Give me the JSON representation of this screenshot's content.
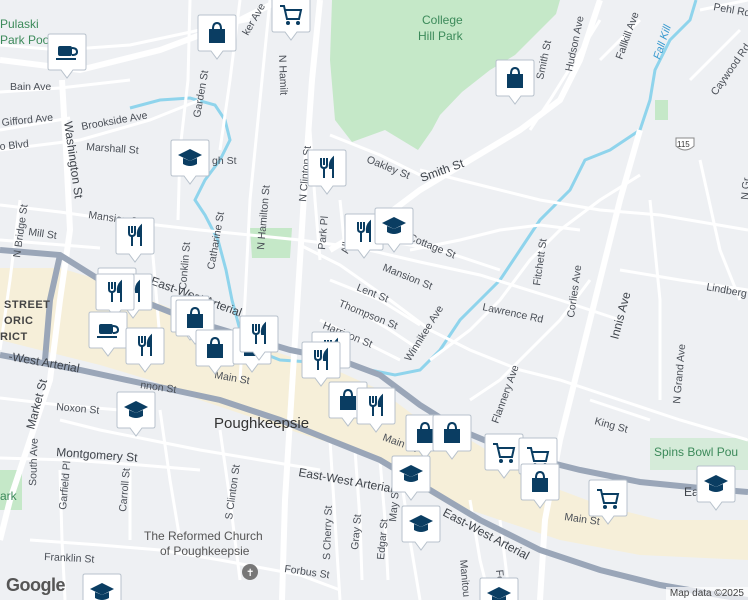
{
  "attribution": {
    "logo": "Google",
    "map_data": "Map data ©2025"
  },
  "places": {
    "city": "Poughkeepsie",
    "park": [
      "College",
      "Hill Park"
    ],
    "park_left": [
      "Pulaski",
      "Park Pool"
    ],
    "district": [
      "STREET",
      "ORIC",
      "RICT"
    ],
    "church": [
      "The Reformed Church",
      "of Poughkeepsie"
    ],
    "spins": "Spins Bowl Pou",
    "park_small": "ark",
    "fall_kill": "Fall Kill"
  },
  "roads": {
    "smith_st": "Smith St",
    "smith_st2": "Smith St",
    "washington_st": "Washington St",
    "market_st": "Market St",
    "east_west_arterial": "East-West Arterial",
    "east_west_arterial_w": "-West Arterial",
    "east_west_arterial_e": "East-West Arterial",
    "east_west_arterial_se": "East-West Arterial",
    "east_west_arterial_far": "East",
    "main_st": "Main St",
    "main_st_e": "Main St",
    "main_st_w": "Main St",
    "innis_ave": "Innis Ave",
    "mansion_st_w": "Mansion St",
    "mansion_st": "Mansion St",
    "lent_st": "Lent St",
    "thompson_st": "Thompson St",
    "harrison_st": "Harrison St",
    "winnikee_ave": "Winnikee Ave",
    "lawrence_rd": "Lawrence Rd",
    "fitchett_st": "Fitchett St",
    "corlies_ave": "Corlies Ave",
    "flannery_ave": "Flannery Ave",
    "king_st": "King St",
    "n_grand_ave": "N Grand Ave",
    "lindberg": "Lindberg",
    "hudson_ave": "Hudson Ave",
    "fallkill_ave": "Fallkill Ave",
    "caywood_rd": "Caywood Rd",
    "pehl_rd": "Pehl Rd",
    "oakley_st": "Oakley St",
    "cottage_st": "Cottage St",
    "allen_pl": "Allen Pl",
    "park_pl": "Park Pl",
    "n_clinton_st": "N Clinton St",
    "n_hamilton_st": "N Hamilton St",
    "n_hamilton_top": "N Hamilt",
    "catharine_st": "Catharine St",
    "conklin_st": "Conklin St",
    "garden_st": "Garden St",
    "mill_st": "Mill St",
    "n_bridge_st": "N Bridge St",
    "marshall_st": "Marshall St",
    "brookside_ave": "Brookside Ave",
    "gifford_ave": "Gifford Ave",
    "bain_ave": "Bain Ave",
    "blvd": "o Blvd",
    "noxon_st": "Noxon St",
    "montgomery_st": "Montgomery St",
    "garfield_pl": "Garfield Pl",
    "carroll_st": "Carroll St",
    "south_ave": "South Ave",
    "franklin_st": "Franklin St",
    "s_clinton_st": "S Clinton St",
    "s_cherry_st": "S Cherry St",
    "gray_st": "Gray St",
    "edgar_st": "Edgar St",
    "may_st": "May St",
    "forbus_st": "Forbus St",
    "cannon_st": "nnon St",
    "ugh_st": "gh St",
    "ker_ave": "ker Ave",
    "manitou": "Manitou",
    "fount": "Fount",
    "route": "115",
    "n_gr": "N Gr"
  },
  "markers": [
    {
      "type": "coffee-shop",
      "icon": "coffee-icon"
    },
    {
      "type": "shopping",
      "icon": "shopping-bag-icon"
    },
    {
      "type": "grocery",
      "icon": "shopping-cart-icon"
    },
    {
      "type": "shopping",
      "icon": "shopping-bag-icon"
    },
    {
      "type": "school",
      "icon": "graduation-cap-icon"
    },
    {
      "type": "restaurant",
      "icon": "fork-knife-icon"
    },
    {
      "type": "restaurant",
      "icon": "fork-knife-icon"
    },
    {
      "type": "school",
      "icon": "graduation-cap-icon"
    },
    {
      "type": "restaurant",
      "icon": "fork-knife-icon"
    },
    {
      "type": "restaurant",
      "icon": "fork-knife-icon"
    },
    {
      "type": "restaurant",
      "icon": "fork-knife-icon"
    },
    {
      "type": "restaurant",
      "icon": "fork-knife-icon"
    },
    {
      "type": "shopping",
      "icon": "shopping-bag-icon"
    },
    {
      "type": "shopping",
      "icon": "shopping-bag-icon"
    },
    {
      "type": "coffee-shop",
      "icon": "coffee-icon"
    },
    {
      "type": "restaurant",
      "icon": "fork-knife-icon"
    },
    {
      "type": "shopping",
      "icon": "shopping-bag-icon"
    },
    {
      "type": "shopping",
      "icon": "shopping-bag-icon"
    },
    {
      "type": "restaurant",
      "icon": "fork-knife-icon"
    },
    {
      "type": "restaurant",
      "icon": "fork-knife-icon"
    },
    {
      "type": "restaurant",
      "icon": "fork-knife-icon"
    },
    {
      "type": "shopping",
      "icon": "shopping-bag-icon"
    },
    {
      "type": "restaurant",
      "icon": "fork-knife-icon"
    },
    {
      "type": "school",
      "icon": "graduation-cap-icon"
    },
    {
      "type": "shopping",
      "icon": "shopping-bag-icon"
    },
    {
      "type": "shopping",
      "icon": "shopping-bag-icon"
    },
    {
      "type": "grocery",
      "icon": "shopping-cart-icon"
    },
    {
      "type": "grocery",
      "icon": "shopping-cart-icon"
    },
    {
      "type": "shopping",
      "icon": "shopping-bag-icon"
    },
    {
      "type": "school",
      "icon": "graduation-cap-icon"
    },
    {
      "type": "school",
      "icon": "graduation-cap-icon"
    },
    {
      "type": "grocery",
      "icon": "shopping-cart-icon"
    },
    {
      "type": "school",
      "icon": "graduation-cap-icon"
    },
    {
      "type": "school",
      "icon": "graduation-cap-icon"
    },
    {
      "type": "school",
      "icon": "graduation-cap-icon"
    }
  ],
  "colors": {
    "background": "#eef0f3",
    "park": "#c5e8c8",
    "water": "#8fd4ec",
    "arterial": "#9aa6b8",
    "road": "#ffffff",
    "downtown": "#f6efd9",
    "marker": "#0a3d62"
  }
}
